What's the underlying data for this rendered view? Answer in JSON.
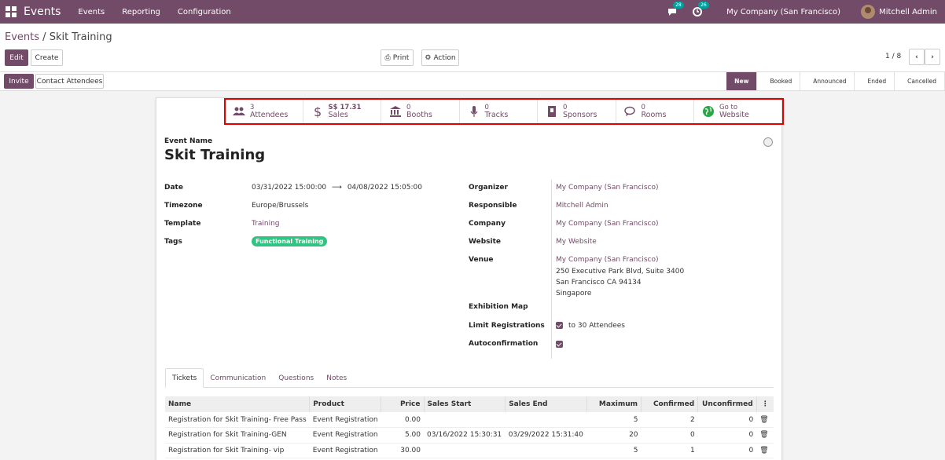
{
  "navbar": {
    "app_name": "Events",
    "menu": [
      "Events",
      "Reporting",
      "Configuration"
    ],
    "messages_count": "28",
    "activities_count": "26",
    "company": "My Company (San Francisco)",
    "user": "Mitchell Admin",
    "bg_color": "#714b67"
  },
  "control_panel": {
    "breadcrumb_parent": "Events",
    "breadcrumb_sep": "/",
    "breadcrumb_current": "Skit Training",
    "edit_label": "Edit",
    "create_label": "Create",
    "print_label": "Print",
    "action_label": "Action",
    "pager": "1 / 8"
  },
  "statusbar": {
    "invite_label": "Invite",
    "contact_label": "Contact Attendees",
    "stages": [
      "New",
      "Booked",
      "Announced",
      "Ended",
      "Cancelled"
    ],
    "active_stage": "New"
  },
  "smart_buttons": [
    {
      "value": "3",
      "label": "Attendees",
      "icon": "users-icon"
    },
    {
      "value": "S$ 17.31",
      "label": "Sales",
      "icon": "dollar-icon"
    },
    {
      "value": "0",
      "label": "Booths",
      "icon": "bank-icon"
    },
    {
      "value": "0",
      "label": "Tracks",
      "icon": "microphone-icon"
    },
    {
      "value": "0",
      "label": "Sponsors",
      "icon": "sponsor-icon"
    },
    {
      "value": "0",
      "label": "Rooms",
      "icon": "chat-icon"
    },
    {
      "value": "Go to",
      "label": "Website",
      "icon": "globe-icon"
    }
  ],
  "form": {
    "event_name_label": "Event Name",
    "event_name": "Skit Training",
    "left": {
      "date_label": "Date",
      "date_start": "03/31/2022 15:00:00",
      "date_end": "04/08/2022 15:05:00",
      "timezone_label": "Timezone",
      "timezone": "Europe/Brussels",
      "template_label": "Template",
      "template": "Training",
      "tags_label": "Tags",
      "tag": "Functional Training"
    },
    "right": {
      "organizer_label": "Organizer",
      "organizer": "My Company (San Francisco)",
      "responsible_label": "Responsible",
      "responsible": "Mitchell Admin",
      "company_label": "Company",
      "company": "My Company (San Francisco)",
      "website_label": "Website",
      "website": "My Website",
      "venue_label": "Venue",
      "venue_name": "My Company (San Francisco)",
      "venue_street": "250 Executive Park Blvd, Suite 3400",
      "venue_city": "San Francisco CA 94134",
      "venue_country": "Singapore",
      "exhibition_label": "Exhibition Map",
      "limit_label": "Limit Registrations",
      "limit_value": "to 30 Attendees",
      "autoconfirm_label": "Autoconfirmation"
    }
  },
  "notebook": {
    "tabs": [
      "Tickets",
      "Communication",
      "Questions",
      "Notes"
    ],
    "active_tab": "Tickets"
  },
  "tickets": {
    "columns": [
      "Name",
      "Product",
      "Price",
      "Sales Start",
      "Sales End",
      "Maximum",
      "Confirmed",
      "Unconfirmed"
    ],
    "rows": [
      {
        "name": "Registration for Skit Training- Free Pass",
        "product": "Event Registration",
        "price": "0.00",
        "sales_start": "",
        "sales_end": "",
        "maximum": "5",
        "confirmed": "2",
        "unconfirmed": "0"
      },
      {
        "name": "Registration for Skit Training-GEN",
        "product": "Event Registration",
        "price": "5.00",
        "sales_start": "03/16/2022 15:30:31",
        "sales_end": "03/29/2022 15:31:40",
        "maximum": "20",
        "confirmed": "0",
        "unconfirmed": "0"
      },
      {
        "name": "Registration for Skit Training- vip",
        "product": "Event Registration",
        "price": "30.00",
        "sales_start": "",
        "sales_end": "",
        "maximum": "5",
        "confirmed": "1",
        "unconfirmed": "0"
      }
    ]
  }
}
